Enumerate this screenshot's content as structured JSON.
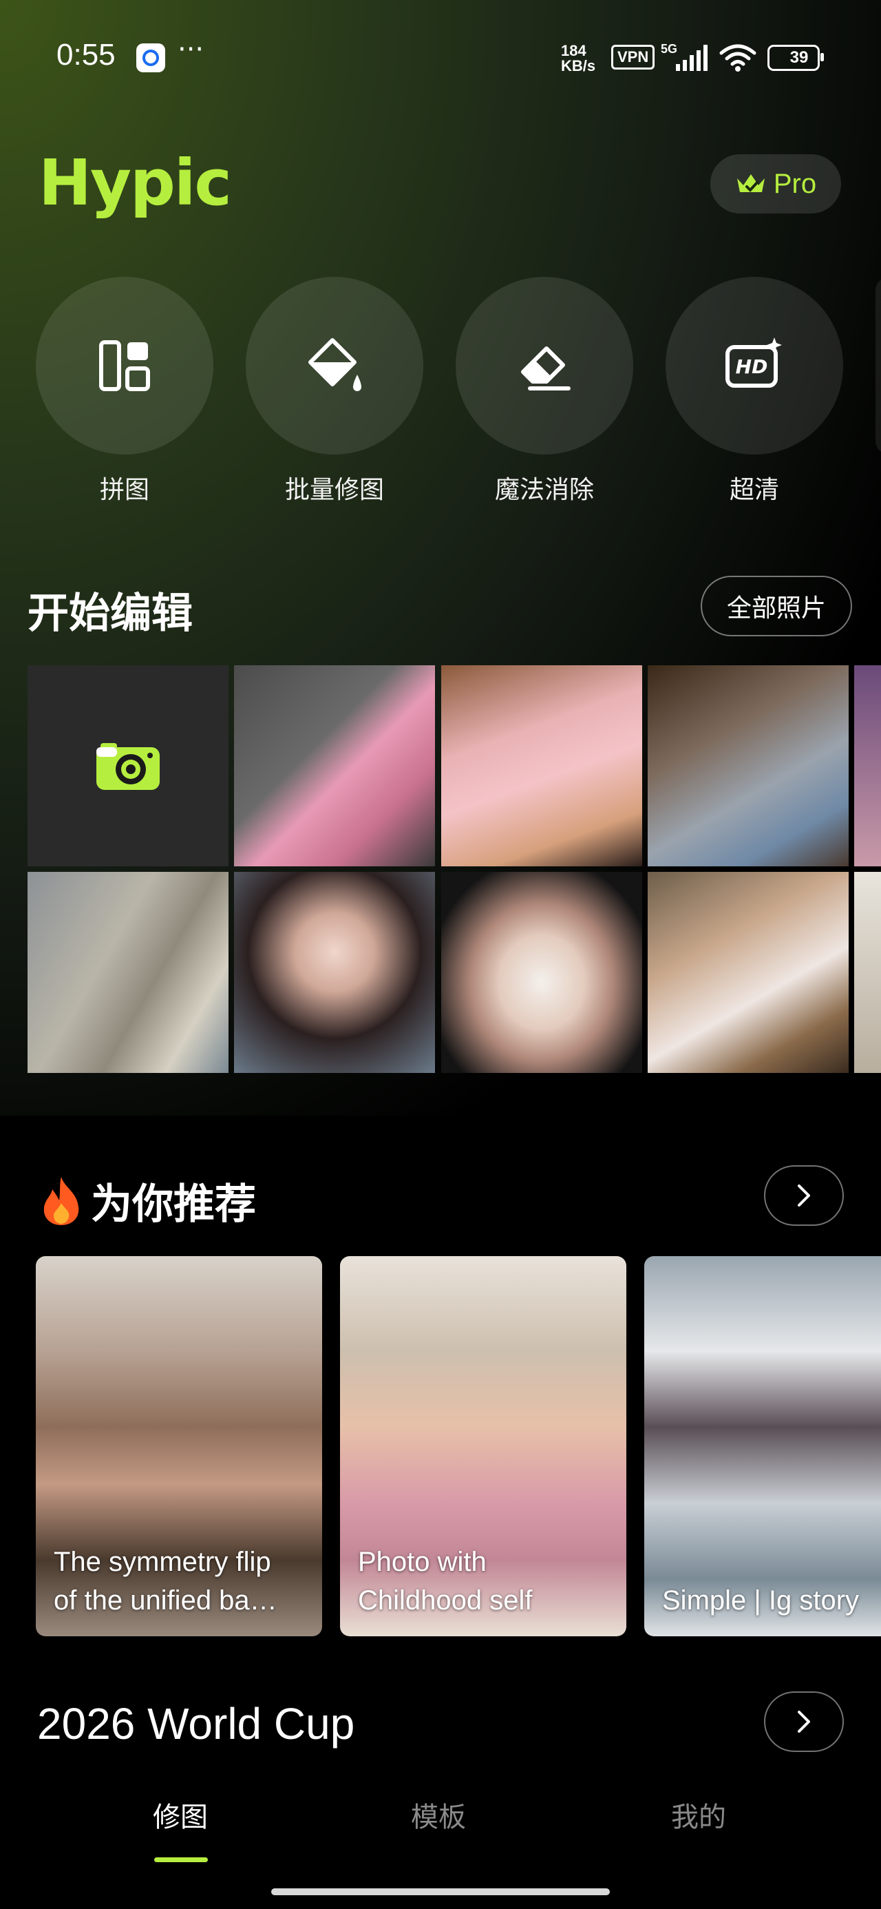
{
  "status_bar": {
    "time": "0:55",
    "net_speed_value": "184",
    "net_speed_unit": "KB/s",
    "vpn": "VPN",
    "network": "5G",
    "battery": "39"
  },
  "header": {
    "logo": "Hypic",
    "pro_label": "Pro"
  },
  "tools": [
    {
      "label": "拼图",
      "icon": "collage-icon"
    },
    {
      "label": "批量修图",
      "icon": "paint-bucket-icon"
    },
    {
      "label": "魔法消除",
      "icon": "eraser-icon"
    },
    {
      "label": "超清",
      "icon": "hd-icon"
    }
  ],
  "start_edit": {
    "title": "开始编辑",
    "all_photos_label": "全部照片"
  },
  "recommend": {
    "title": "为你推荐",
    "cards": [
      {
        "title": "The symmetry flip\nof the unified ba…"
      },
      {
        "title": "Photo with\nChildhood self"
      },
      {
        "title": "Simple | Ig story"
      }
    ]
  },
  "world_cup": {
    "title": "2026 World Cup"
  },
  "bottom_nav": {
    "items": [
      "修图",
      "模板",
      "我的"
    ],
    "active_index": 0
  },
  "colors": {
    "accent": "#b6ee3f",
    "background": "#000000"
  }
}
